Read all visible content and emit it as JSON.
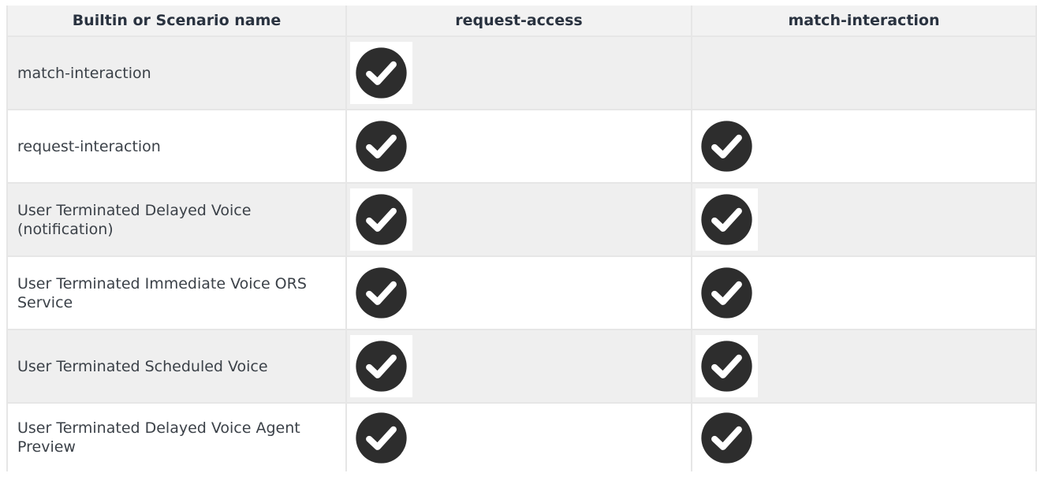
{
  "columns": [
    "Builtin or Scenario name",
    "request-access",
    "match-interaction"
  ],
  "rows": [
    {
      "name": "match-interaction",
      "request_access": true,
      "match_interaction": false
    },
    {
      "name": "request-interaction",
      "request_access": true,
      "match_interaction": true
    },
    {
      "name": "User Terminated Delayed Voice (notification)",
      "request_access": true,
      "match_interaction": true
    },
    {
      "name": "User Terminated Immediate Voice ORS Service",
      "request_access": true,
      "match_interaction": true
    },
    {
      "name": "User Terminated Scheduled Voice",
      "request_access": true,
      "match_interaction": true
    },
    {
      "name": "User Terminated Delayed Voice Agent Preview",
      "request_access": true,
      "match_interaction": true
    }
  ],
  "icon": "check-circle-icon",
  "colors": {
    "check_fill": "#2d2d2d",
    "row_alt": "#efefef",
    "border": "#e6e6e6"
  }
}
